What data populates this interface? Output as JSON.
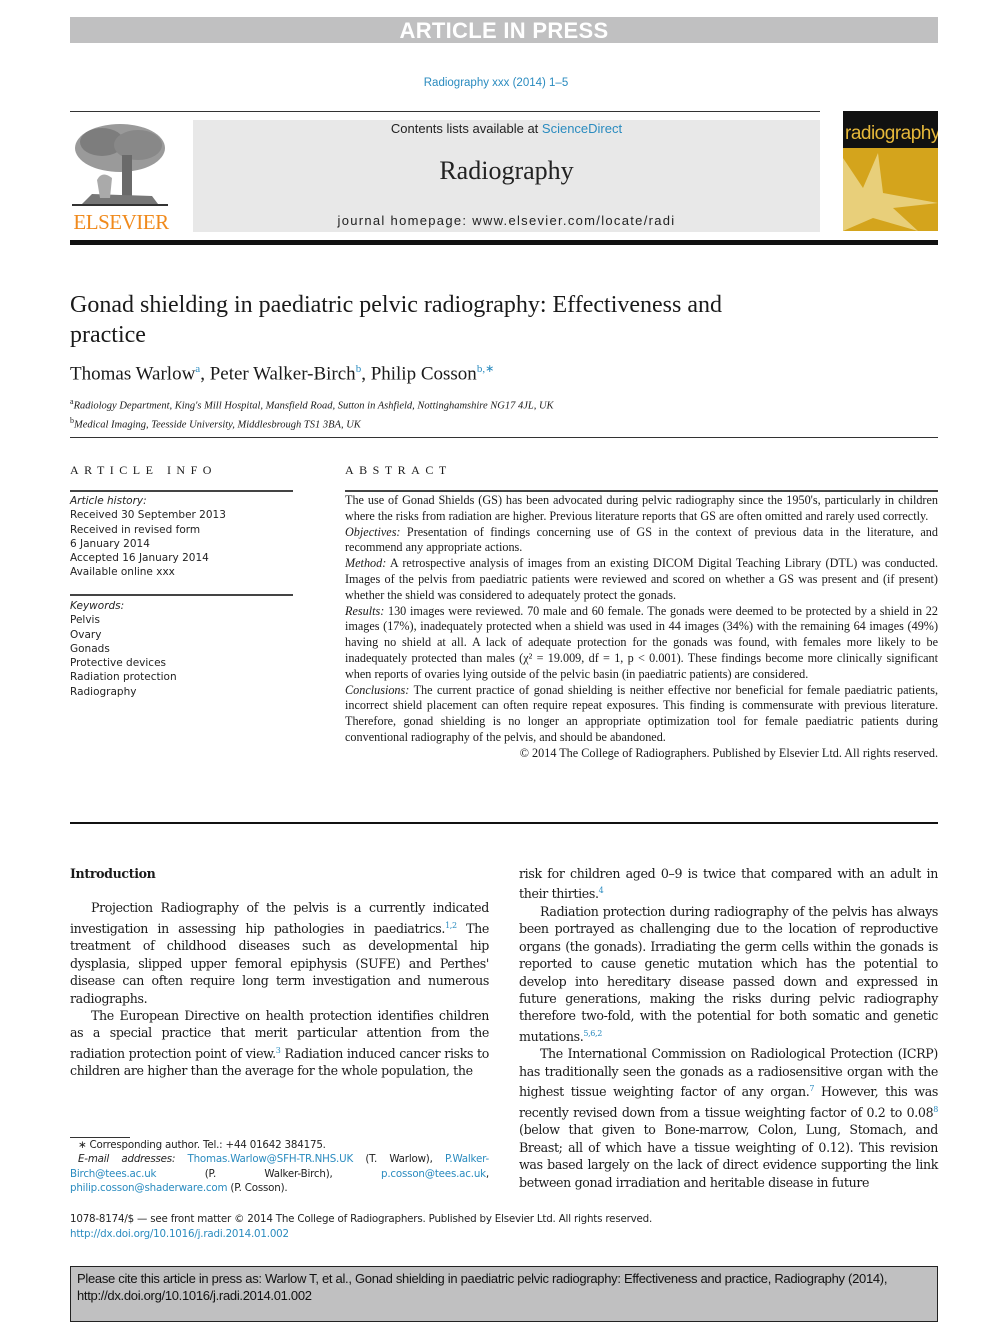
{
  "banner": "ARTICLE IN PRESS",
  "journal_ref": "Radiography xxx (2014) 1–5",
  "masthead": {
    "contents_prefix": "Contents lists available at ",
    "contents_link": "ScienceDirect",
    "journal_title": "Radiography",
    "homepage": "journal homepage: www.elsevier.com/locate/radi",
    "publisher_logo": "ELSEVIER",
    "cover_title": "radiography"
  },
  "article": {
    "title": "Gonad shielding in paediatric pelvic radiography: Effectiveness and practice",
    "authors": [
      {
        "name": "Thomas Warlow",
        "sup": "a"
      },
      {
        "name": "Peter Walker-Birch",
        "sup": "b"
      },
      {
        "name": "Philip Cosson",
        "sup": "b,∗"
      }
    ],
    "affiliations": [
      {
        "sup": "a",
        "text": "Radiology Department, King's Mill Hospital, Mansfield Road, Sutton in Ashfield, Nottinghamshire NG17 4JL, UK"
      },
      {
        "sup": "b",
        "text": "Medical Imaging, Teesside University, Middlesbrough TS1 3BA, UK"
      }
    ]
  },
  "article_info": {
    "heading": "ARTICLE INFO",
    "history_label": "Article history:",
    "history": [
      "Received 30 September 2013",
      "Received in revised form",
      "6 January 2014",
      "Accepted 16 January 2014",
      "Available online xxx"
    ],
    "keywords_label": "Keywords:",
    "keywords": [
      "Pelvis",
      "Ovary",
      "Gonads",
      "Protective devices",
      "Radiation protection",
      "Radiography"
    ]
  },
  "abstract": {
    "heading": "ABSTRACT",
    "intro": "The use of Gonad Shields (GS) has been advocated during pelvic radiography since the 1950's, particularly in children where the risks from radiation are higher. Previous literature reports that GS are often omitted and rarely used correctly.",
    "objectives_label": "Objectives:",
    "objectives": " Presentation of findings concerning use of GS in the context of previous data in the literature, and recommend any appropriate actions.",
    "method_label": "Method:",
    "method": " A retrospective analysis of images from an existing DICOM Digital Teaching Library (DTL) was conducted. Images of the pelvis from paediatric patients were reviewed and scored on whether a GS was present and (if present) whether the shield was considered to adequately protect the gonads.",
    "results_label": "Results:",
    "results": " 130 images were reviewed. 70 male and 60 female. The gonads were deemed to be protected by a shield in 22 images (17%), inadequately protected when a shield was used in 44 images (34%) with the remaining 64 images (49%) having no shield at all. A lack of adequate protection for the gonads was found, with females more likely to be inadequately protected than males (χ² = 19.009, df = 1, p < 0.001). These findings become more clinically significant when reports of ovaries lying outside of the pelvic basin (in paediatric patients) are considered.",
    "conclusions_label": "Conclusions:",
    "conclusions": " The current practice of gonad shielding is neither effective nor beneficial for female paediatric patients, incorrect shield placement can often require repeat exposures. This finding is commensurate with previous literature. Therefore, gonad shielding is no longer an appropriate optimization tool for female paediatric patients during conventional radiography of the pelvis, and should be abandoned.",
    "copyright": "© 2014 The College of Radiographers. Published by Elsevier Ltd. All rights reserved."
  },
  "body": {
    "intro_heading": "Introduction",
    "left": [
      {
        "text": "Projection Radiography of the pelvis is a currently indicated investigation in assessing hip pathologies in paediatrics.",
        "ref": "1,2",
        "after": " The treatment of childhood diseases such as developmental hip dysplasia, slipped upper femoral epiphysis (SUFE) and Perthes' disease can often require long term investigation and numerous radiographs."
      },
      {
        "text": "The European Directive on health protection identifies children as a special practice that merit particular attention from the radiation protection point of view.",
        "ref": "3",
        "after": " Radiation induced cancer risks to children are higher than the average for the whole population, the"
      }
    ],
    "right": [
      {
        "text": "risk for children aged 0–9 is twice that compared with an adult in their thirties.",
        "ref": "4",
        "after": ""
      },
      {
        "text": "Radiation protection during radiography of the pelvis has always been portrayed as challenging due to the location of reproductive organs (the gonads). Irradiating the germ cells within the gonads is reported to cause genetic mutation which has the potential to develop into hereditary disease passed down and expressed in future generations, making the risks during pelvic radiography therefore two-fold, with the potential for both somatic and genetic mutations.",
        "ref": "5,6,2",
        "after": ""
      },
      {
        "text": "The International Commission on Radiological Protection (ICRP) has traditionally seen the gonads as a radiosensitive organ with the highest tissue weighting factor of any organ.",
        "ref": "7",
        "after": " However, this was recently revised down from a tissue weighting factor of 0.2 to 0.08"
      },
      {
        "ref2": "8",
        "after2": " (below that given to Bone-marrow, Colon, Lung, Stomach, and Breast; all of which have a tissue weighting of 0.12). This revision was based largely on the lack of direct evidence supporting the link between gonad irradiation and heritable disease in future"
      }
    ]
  },
  "footnote": {
    "corresponding": "∗ Corresponding author. Tel.: +44 01642 384175.",
    "email_label": "E-mail addresses:",
    "emails": [
      {
        "addr": "Thomas.Warlow@SFH-TR.NHS.UK",
        "who": " (T. Warlow), "
      },
      {
        "addr": "P.Walker-Birch@tees.ac.uk",
        "who": " (P. Walker-Birch), "
      },
      {
        "addr": "p.cosson@tees.ac.uk",
        "who": ", "
      },
      {
        "addr": "philip.cosson@shaderware.com",
        "who": " (P. Cosson)."
      }
    ]
  },
  "issn": {
    "line": "1078-8174/$ — see front matter © 2014 The College of Radiographers. Published by Elsevier Ltd. All rights reserved.",
    "doi": "http://dx.doi.org/10.1016/j.radi.2014.01.002"
  },
  "cite_box": "Please cite this article in press as: Warlow T, et al., Gonad shielding in paediatric pelvic radiography: Effectiveness and practice, Radiography (2014), http://dx.doi.org/10.1016/j.radi.2014.01.002"
}
